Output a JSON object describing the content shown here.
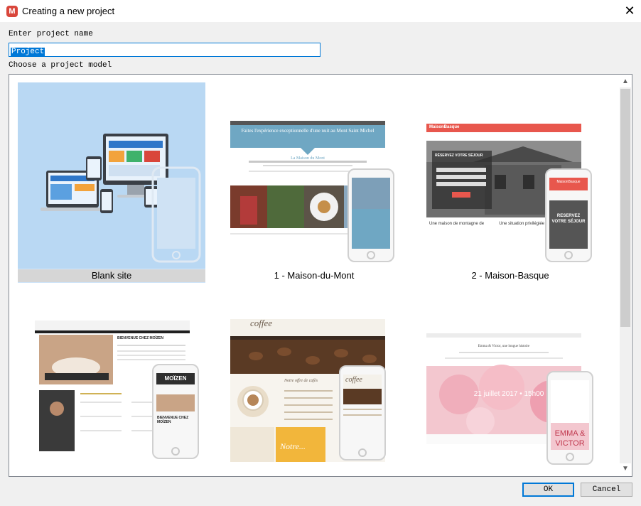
{
  "window": {
    "title": "Creating a new project",
    "close_glyph": "✕",
    "app_icon_glyph": "M"
  },
  "form": {
    "name_label": "Enter project name",
    "name_value": "Project",
    "model_label": "Choose a project model"
  },
  "models": [
    {
      "label": "Blank site",
      "selected": true
    },
    {
      "label": "1 - Maison-du-Mont",
      "selected": false
    },
    {
      "label": "2 - Maison-Basque",
      "selected": false
    },
    {
      "label": "",
      "selected": false
    },
    {
      "label": "",
      "selected": false
    },
    {
      "label": "",
      "selected": false
    }
  ],
  "previews": {
    "mont_headline": "Faites l'expérience exceptionnelle d'une nuit au Mont Saint Michel",
    "mont_title": "La Maison du Mont",
    "basque_logo": "MaisonBasque",
    "basque_banner": "RÉSERVEZ VOTRE SÉJOUR",
    "basque_mobile": "RESERVEZ VOTRE SÉJOUR",
    "basque_caption_left": "Une maison de montagne de",
    "basque_caption_right": "Une situation privilégiée",
    "moizen_title": "BIENVENUE CHEZ MOÏZEN",
    "moizen_logo": "MOÏZEN",
    "coffee_logo": "coffee",
    "coffee_menu": "Notre offre de cafés",
    "coffee_banner": "Notre...",
    "emma_names_a": "EMMA &",
    "emma_names_b": "VICTOR",
    "emma_date": "21 juillet 2017 • 15h00",
    "emma_heading": "Emma & Victor, une longue histoire"
  },
  "buttons": {
    "ok": "OK",
    "cancel": "Cancel"
  },
  "colors": {
    "accent": "#0078d7",
    "selection": "#cfe4f8",
    "brand": "#d9463b"
  }
}
